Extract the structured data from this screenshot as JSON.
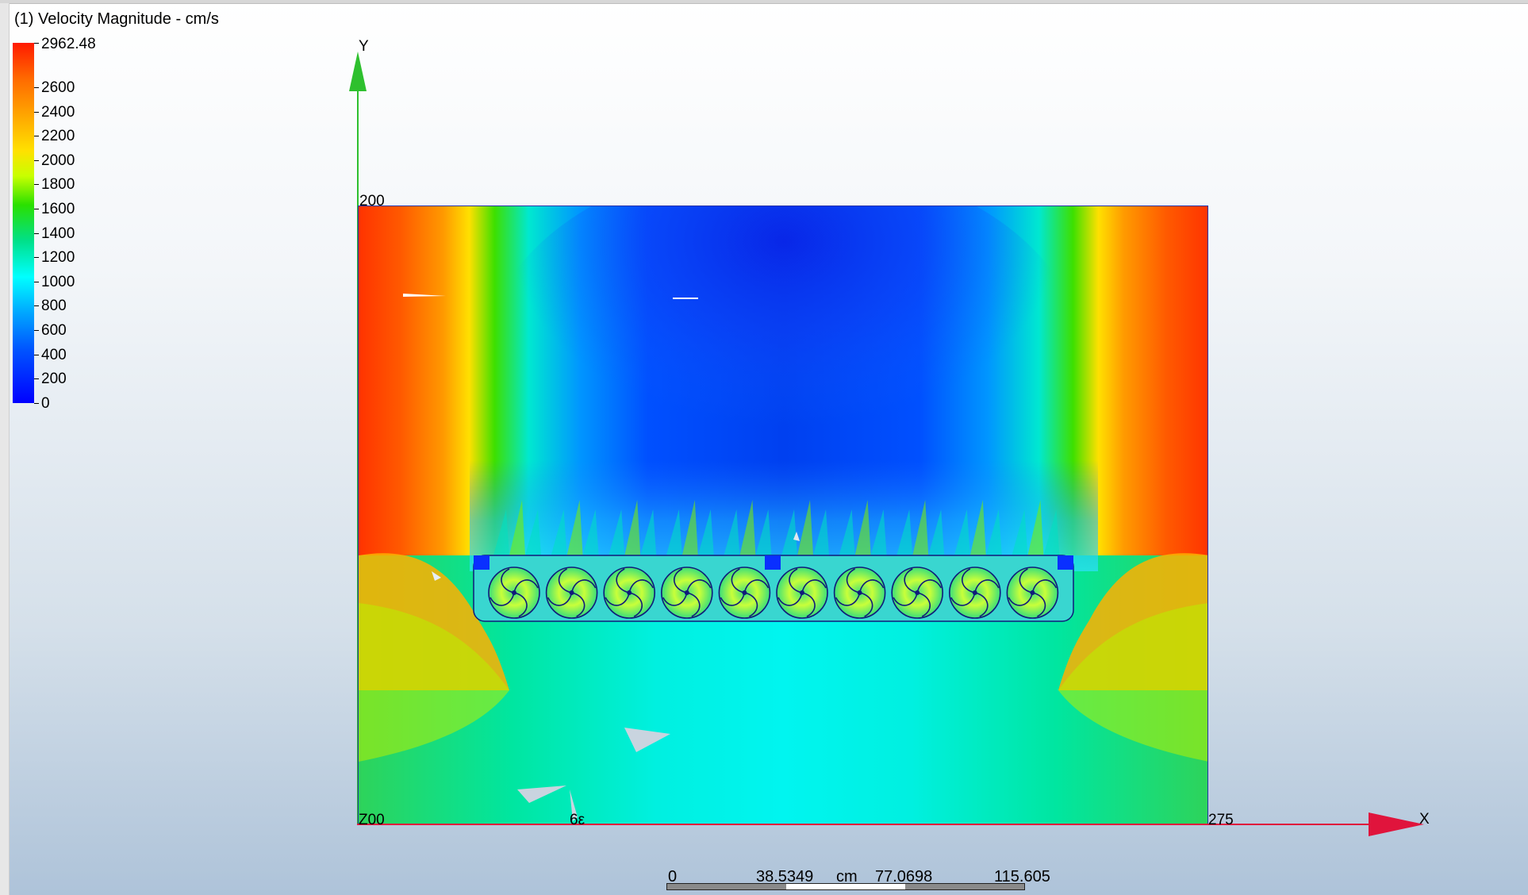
{
  "window": {
    "title": "(1) Velocity Magnitude - cm/s"
  },
  "legend": {
    "max_label": "2962.48",
    "labels": [
      "2600",
      "2400",
      "2200",
      "2000",
      "1800",
      "1600",
      "1400",
      "1200",
      "1000",
      "800",
      "600",
      "400",
      "200",
      "0"
    ]
  },
  "axes": {
    "y_label": "Y",
    "x_label": "X",
    "y_top_tick": "200",
    "x_right_tick": "275",
    "origin_tick": "Z00",
    "x_mid_tick": "6ε"
  },
  "scale_bar": {
    "labels": [
      "0",
      "38.5349",
      "cm",
      "77.0698",
      "115.605"
    ]
  },
  "colors": {
    "y_axis": "#2ec02e",
    "x_axis": "#e0143c",
    "domain_border": "#2533a8",
    "rotor_outline": "#101a7a"
  },
  "rotors": {
    "count": 10
  }
}
